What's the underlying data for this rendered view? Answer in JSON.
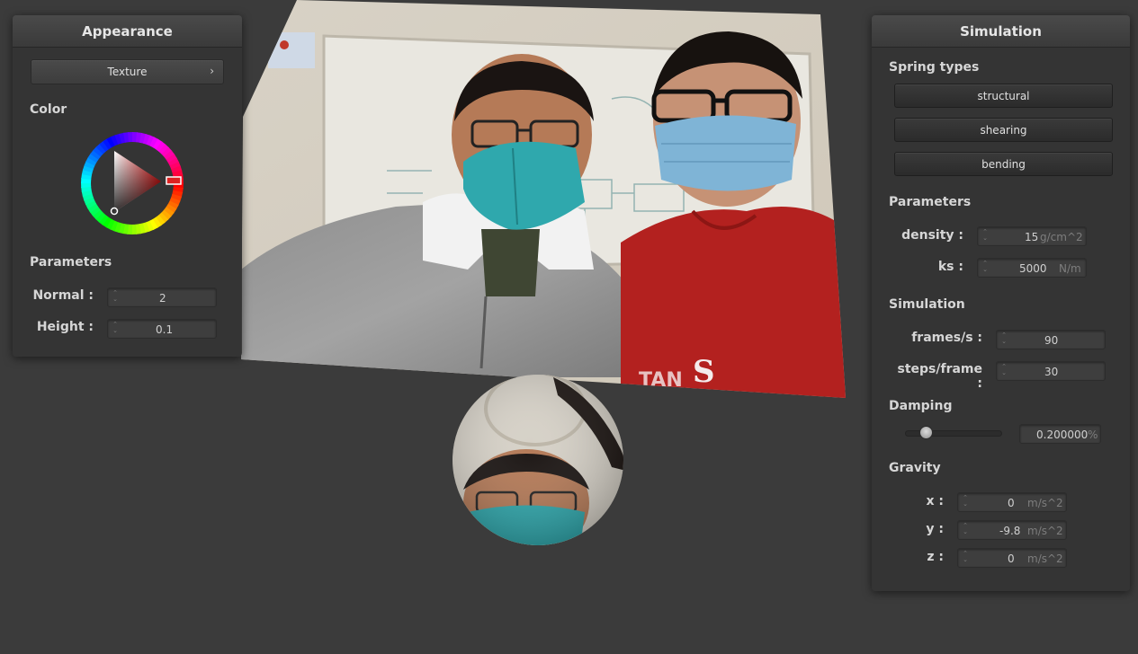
{
  "appearance": {
    "title": "Appearance",
    "texture_button": "Texture",
    "color_label": "Color",
    "parameters_label": "Parameters",
    "normal_label": "Normal :",
    "normal_value": "2",
    "height_label": "Height :",
    "height_value": "0.1"
  },
  "simulation": {
    "title": "Simulation",
    "spring_types_label": "Spring types",
    "spring_buttons": [
      "structural",
      "shearing",
      "bending"
    ],
    "parameters_label": "Parameters",
    "density_label": "density :",
    "density_value": "15",
    "density_unit": "g/cm^2",
    "ks_label": "ks :",
    "ks_value": "5000",
    "ks_unit": "N/m",
    "simulation_label": "Simulation",
    "fps_label": "frames/s :",
    "fps_value": "90",
    "steps_label": "steps/frame :",
    "steps_value": "30",
    "damping_label": "Damping",
    "damping_value": "0.200000",
    "damping_unit": "%",
    "damping_fraction": 0.2,
    "gravity_label": "Gravity",
    "gx_label": "x :",
    "gx_value": "0",
    "gy_label": "y :",
    "gy_value": "-9.8",
    "gz_label": "z :",
    "gz_value": "0",
    "g_unit": "m/s^2"
  },
  "colors": {
    "background": "#3b3b3b",
    "panel": "#343434",
    "selected_color": "#cc1a1a"
  },
  "icons": [
    "chevron-right-icon",
    "spinner-icon",
    "color-wheel-icon"
  ]
}
